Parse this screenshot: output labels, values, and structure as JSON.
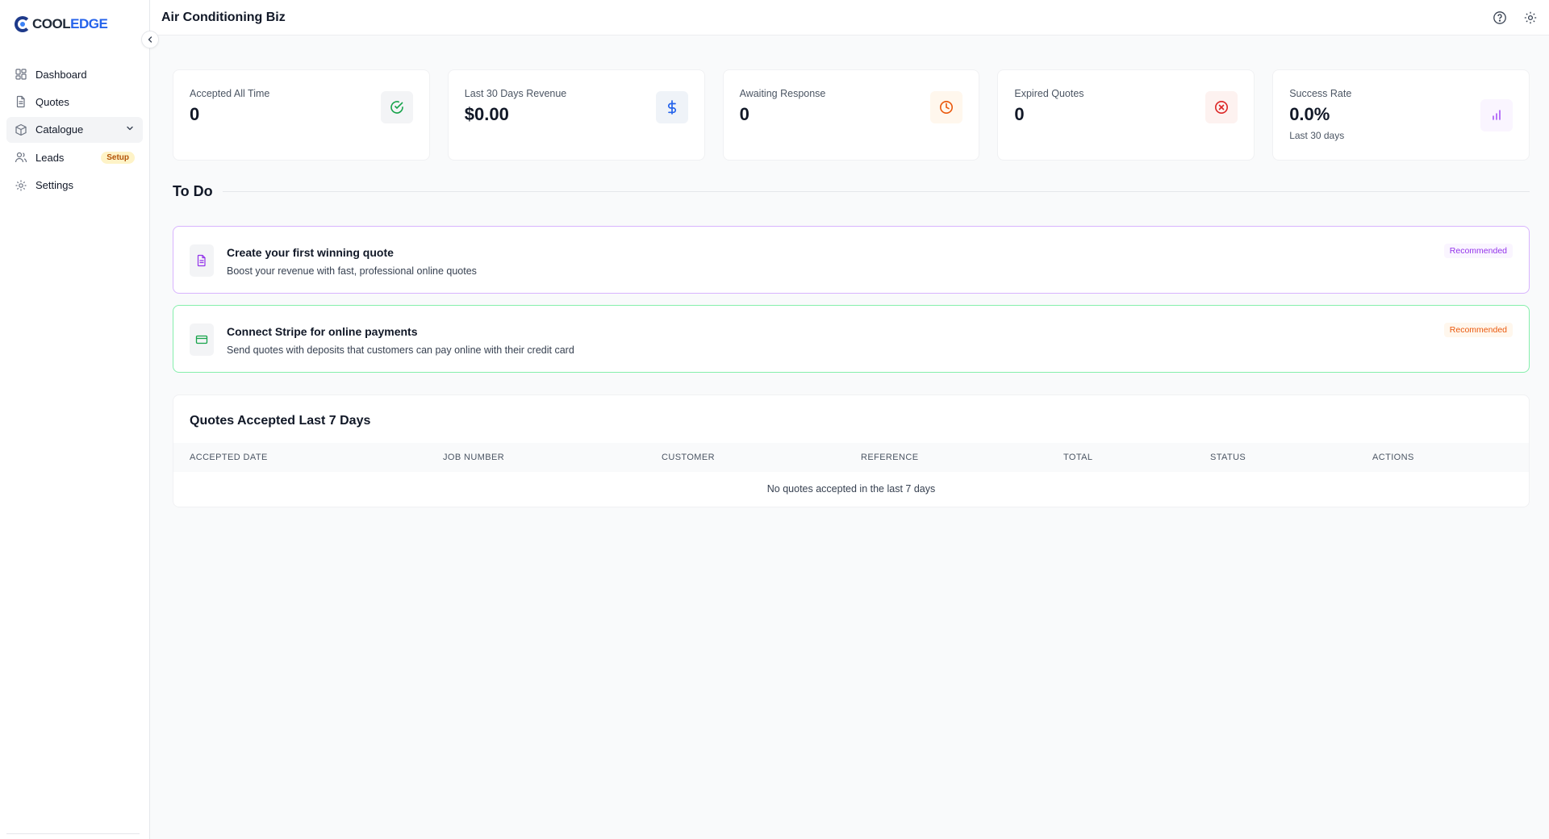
{
  "brand": {
    "part1": "COOL",
    "part2": "EDGE"
  },
  "sidebar": {
    "items": [
      {
        "label": "Dashboard"
      },
      {
        "label": "Quotes"
      },
      {
        "label": "Catalogue"
      },
      {
        "label": "Leads",
        "badge": "Setup"
      },
      {
        "label": "Settings"
      }
    ]
  },
  "header": {
    "title": "Air Conditioning Biz"
  },
  "stats": [
    {
      "label": "Accepted All Time",
      "value": "0",
      "icon": "check-circle-icon",
      "color": "#16a34a"
    },
    {
      "label": "Last 30 Days Revenue",
      "value": "$0.00",
      "icon": "dollar-icon",
      "color": "#2563eb"
    },
    {
      "label": "Awaiting Response",
      "value": "0",
      "icon": "clock-icon",
      "color": "#ea580c"
    },
    {
      "label": "Expired Quotes",
      "value": "0",
      "icon": "x-circle-icon",
      "color": "#dc2626"
    },
    {
      "label": "Success Rate",
      "value": "0.0%",
      "sub": "Last 30 days",
      "icon": "bar-chart-icon",
      "color": "#a855f7"
    }
  ],
  "todo": {
    "heading": "To Do",
    "items": [
      {
        "title": "Create your first winning quote",
        "desc": "Boost your revenue with fast, professional online quotes",
        "badge": "Recommended",
        "accent": "#d8b4fe"
      },
      {
        "title": "Connect Stripe for online payments",
        "desc": "Send quotes with deposits that customers can pay online with their credit card",
        "badge": "Recommended",
        "accent": "#86efac"
      }
    ]
  },
  "recent": {
    "title": "Quotes Accepted Last 7 Days",
    "columns": [
      "ACCEPTED DATE",
      "JOB NUMBER",
      "CUSTOMER",
      "REFERENCE",
      "TOTAL",
      "STATUS",
      "ACTIONS"
    ],
    "empty": "No quotes accepted in the last 7 days"
  }
}
